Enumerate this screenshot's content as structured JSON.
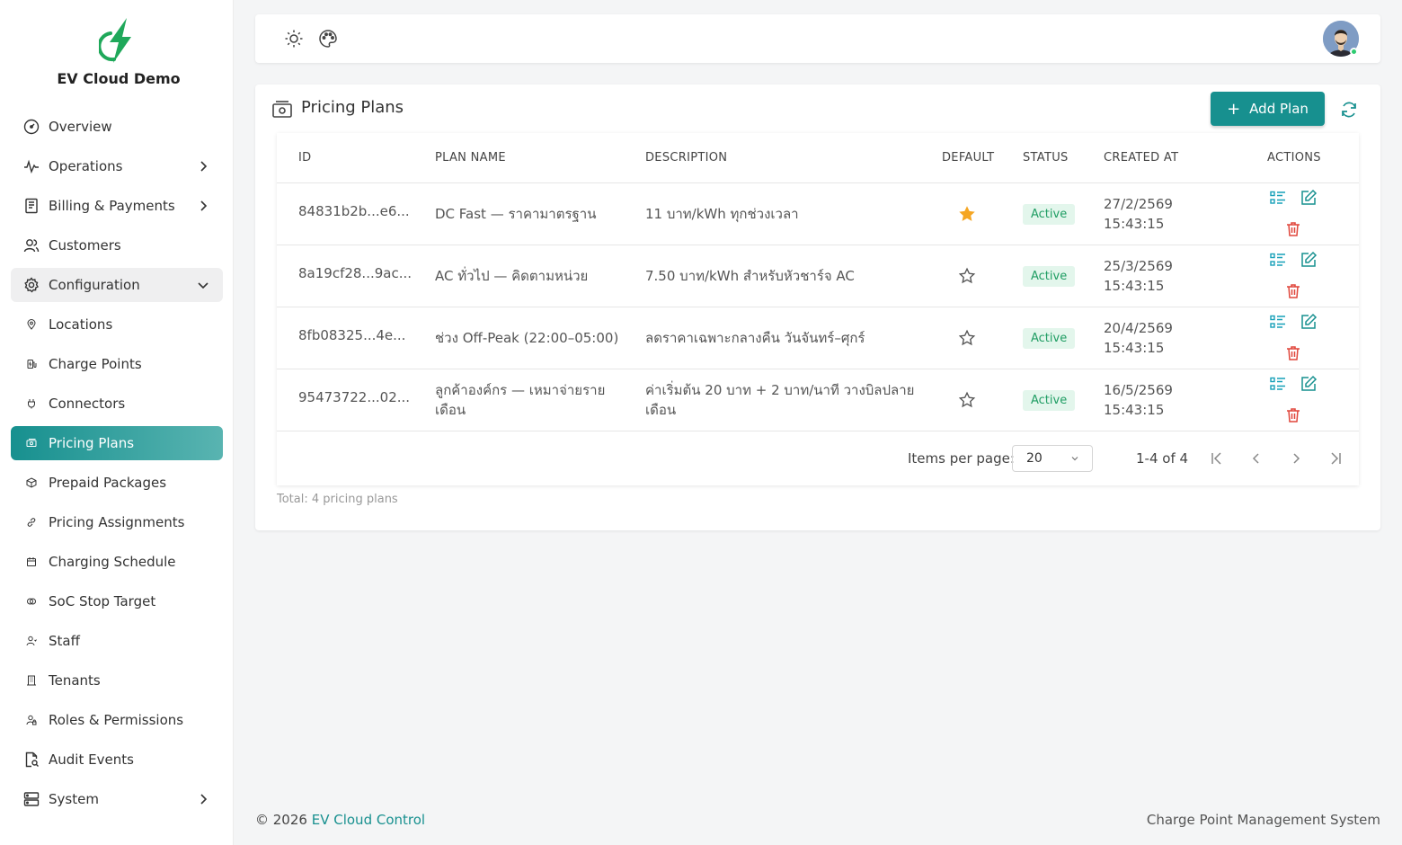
{
  "app": {
    "name": "EV Cloud Demo"
  },
  "sidebar": {
    "items": [
      {
        "label": "Overview",
        "icon": "gauge-icon"
      },
      {
        "label": "Operations",
        "icon": "pulse-icon",
        "chevron": "right"
      },
      {
        "label": "Billing & Payments",
        "icon": "receipt-icon",
        "chevron": "right"
      },
      {
        "label": "Customers",
        "icon": "users-icon"
      },
      {
        "label": "Configuration",
        "icon": "gear-icon",
        "chevron": "down",
        "expanded": true
      },
      {
        "label": "Locations",
        "icon": "pin-icon"
      },
      {
        "label": "Charge Points",
        "icon": "charger-icon"
      },
      {
        "label": "Connectors",
        "icon": "plug-icon"
      },
      {
        "label": "Pricing Plans",
        "icon": "money-icon",
        "active": true
      },
      {
        "label": "Prepaid Packages",
        "icon": "box-icon"
      },
      {
        "label": "Pricing Assignments",
        "icon": "link-icon"
      },
      {
        "label": "Charging Schedule",
        "icon": "calendar-icon"
      },
      {
        "label": "SoC Stop Target",
        "icon": "target-icon"
      },
      {
        "label": "Staff",
        "icon": "staff-icon"
      },
      {
        "label": "Tenants",
        "icon": "building-icon"
      },
      {
        "label": "Roles & Permissions",
        "icon": "lock-icon"
      },
      {
        "label": "Audit Events",
        "icon": "file-search-icon"
      },
      {
        "label": "System",
        "icon": "server-icon",
        "chevron": "right"
      }
    ]
  },
  "topbar": {
    "theme_icon": "sun-icon",
    "palette_icon": "palette-icon"
  },
  "page": {
    "title": "Pricing Plans",
    "add_button": "Add Plan",
    "columns": [
      "ID",
      "PLAN NAME",
      "DESCRIPTION",
      "DEFAULT",
      "STATUS",
      "CREATED AT",
      "ACTIONS"
    ],
    "rows": [
      {
        "id": "84831b2b...e6...",
        "name": "DC Fast — ราคามาตรฐาน",
        "description": "11 บาท/kWh ทุกช่วงเวลา",
        "default": true,
        "status": "Active",
        "created_date": "27/2/2569",
        "created_time": "15:43:15"
      },
      {
        "id": "8a19cf28...9ac...",
        "name": "AC ทั่วไป — คิดตามหน่วย",
        "description": "7.50 บาท/kWh สำหรับหัวชาร์จ AC",
        "default": false,
        "status": "Active",
        "created_date": "25/3/2569",
        "created_time": "15:43:15"
      },
      {
        "id": "8fb08325...4e...",
        "name": "ช่วง Off-Peak (22:00–05:00)",
        "description": "ลดราคาเฉพาะกลางคืน วันจันทร์–ศุกร์",
        "default": false,
        "status": "Active",
        "created_date": "20/4/2569",
        "created_time": "15:43:15"
      },
      {
        "id": "95473722...02...",
        "name": "ลูกค้าองค์กร — เหมาจ่ายรายเดือน",
        "description": "ค่าเริ่มต้น 20 บาท + 2 บาท/นาที วางบิลปลายเดือน",
        "default": false,
        "status": "Active",
        "created_date": "16/5/2569",
        "created_time": "15:43:15"
      }
    ],
    "pagination": {
      "items_per_page_label": "Items per page:",
      "items_per_page": "20",
      "range": "1-4 of 4"
    },
    "total": "Total: 4 pricing plans"
  },
  "footer": {
    "copyright": "© 2026",
    "link": "EV Cloud Control",
    "right": "Charge Point Management System"
  },
  "colors": {
    "accent": "#17908f",
    "active_badge_bg": "#e3f6ec",
    "active_badge_text": "#1f9d63",
    "star": "#f5a623",
    "delete": "#e0453a"
  }
}
